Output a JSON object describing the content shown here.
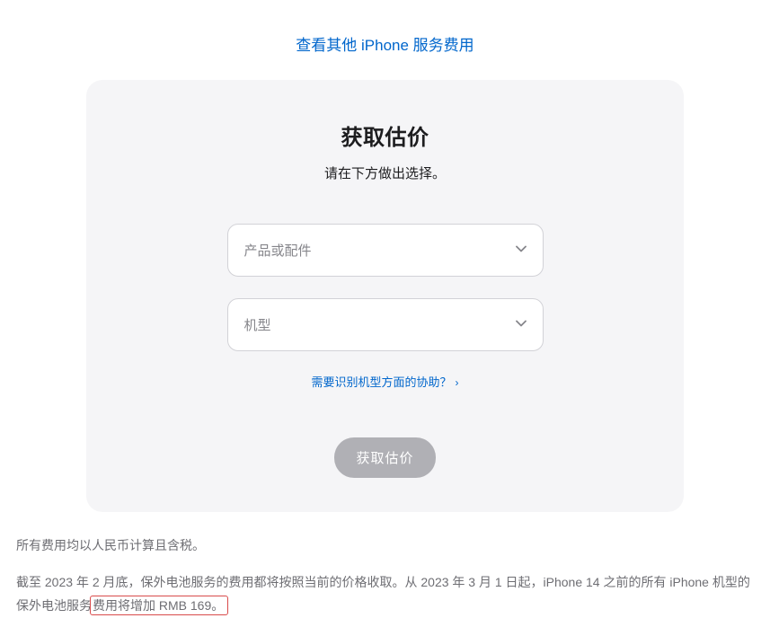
{
  "topLink": "查看其他 iPhone 服务费用",
  "card": {
    "title": "获取估价",
    "subtitle": "请在下方做出选择。",
    "select1Placeholder": "产品或配件",
    "select2Placeholder": "机型",
    "helpLink": "需要识别机型方面的协助？",
    "submitLabel": "获取估价"
  },
  "footer": {
    "para1": "所有费用均以人民币计算且含税。",
    "para2a": "截至 2023 年 2 月底，保外电池服务的费用都将按照当前的价格收取。从 2023 年 3 月 1 日起，iPhone 14 之前的所有 iPhone 机型的保外电池服务",
    "para2b": "费用将增加 RMB 169。"
  }
}
